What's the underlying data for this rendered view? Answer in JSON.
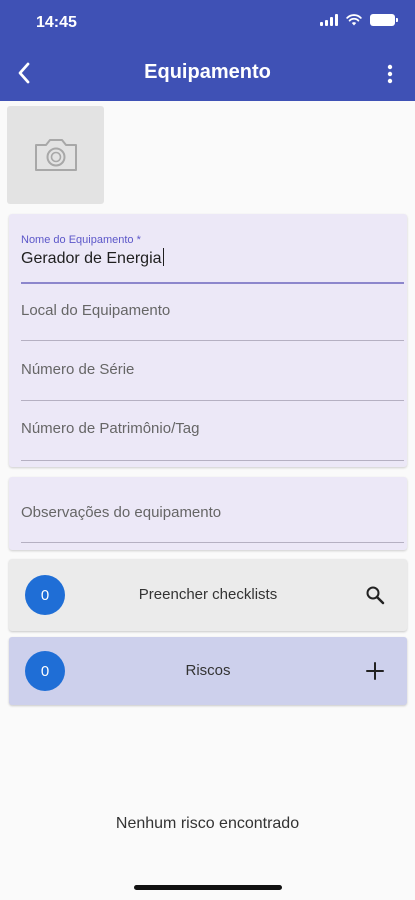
{
  "status_bar": {
    "time": "14:45"
  },
  "header": {
    "title": "Equipamento",
    "back_icon": "chevron-left-icon",
    "menu_icon": "more-vertical-icon"
  },
  "photo": {
    "icon": "camera-icon"
  },
  "form": {
    "name_label": "Nome do Equipamento *",
    "name_value": "Gerador de Energia",
    "location_placeholder": "Local do Equipamento",
    "serial_placeholder": "Número de Série",
    "tag_placeholder": "Número de Patrimônio/Tag",
    "notes_placeholder": "Observações do equipamento"
  },
  "checklists": {
    "count": "0",
    "label": "Preencher checklists",
    "icon": "search-icon"
  },
  "risks": {
    "count": "0",
    "label": "Riscos",
    "icon": "plus-icon"
  },
  "empty_message": "Nenhum risco encontrado",
  "colors": {
    "app_bar": "#3f51b5",
    "card": "#ece8f7",
    "risks_card": "#cdd0ec",
    "checklists_card": "#ebebeb",
    "badge": "#1f6ed6"
  }
}
